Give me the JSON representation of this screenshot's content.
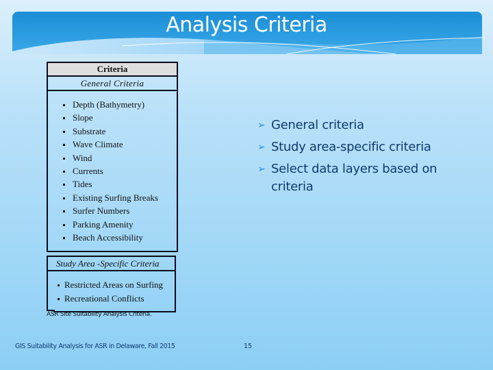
{
  "slide": {
    "title": "Analysis Criteria",
    "table": {
      "header": "Criteria",
      "general_section": "General Criteria",
      "general_items": [
        "Depth (Bathymetry)",
        "Slope",
        "Substrate",
        "Wave Climate",
        "Wind",
        "Currents",
        "Tides",
        "Existing Surfing Breaks",
        "Surfer Numbers",
        "Parking Amenity",
        "Beach Accessibility"
      ],
      "specific_section": "Study Area -Specific Criteria",
      "specific_items": [
        "Restricted Areas on Surfing",
        "Recreational Conflicts"
      ],
      "caption": "ASR Site Suitability Analysis Criteria."
    },
    "bullets": [
      {
        "icon": "arrow-bullet-icon",
        "glyph": "➢",
        "text": "General criteria"
      },
      {
        "icon": "arrow-bullet-icon",
        "glyph": "➢",
        "text": "Study area-specific criteria"
      },
      {
        "icon": "arrow-bullet-icon",
        "glyph": "➢",
        "text": "Select data layers based on criteria"
      }
    ],
    "footer": {
      "left": "GIS Suitability Analysis for ASR in Delaware, Fall 2015",
      "page_number": "15"
    }
  }
}
